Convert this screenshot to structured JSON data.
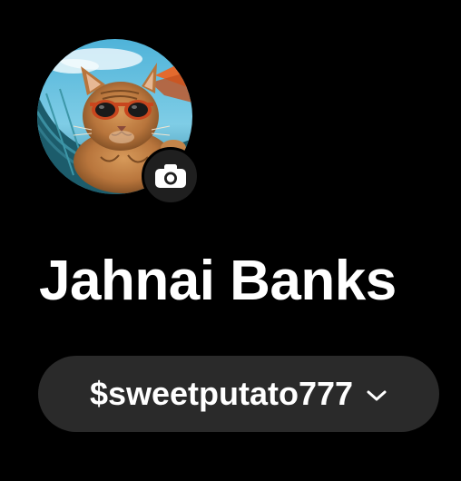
{
  "profile": {
    "display_name": "Jahnai Banks",
    "handle": "$sweetputato777",
    "avatar_icon": "cat-with-sunglasses-in-hammock",
    "camera_icon": "camera-icon",
    "handle_chevron_icon": "chevron-down-icon"
  },
  "colors": {
    "background": "#000000",
    "text": "#ffffff",
    "pill_background": "#2a2a2a",
    "camera_button_background": "#1f1f1f"
  }
}
